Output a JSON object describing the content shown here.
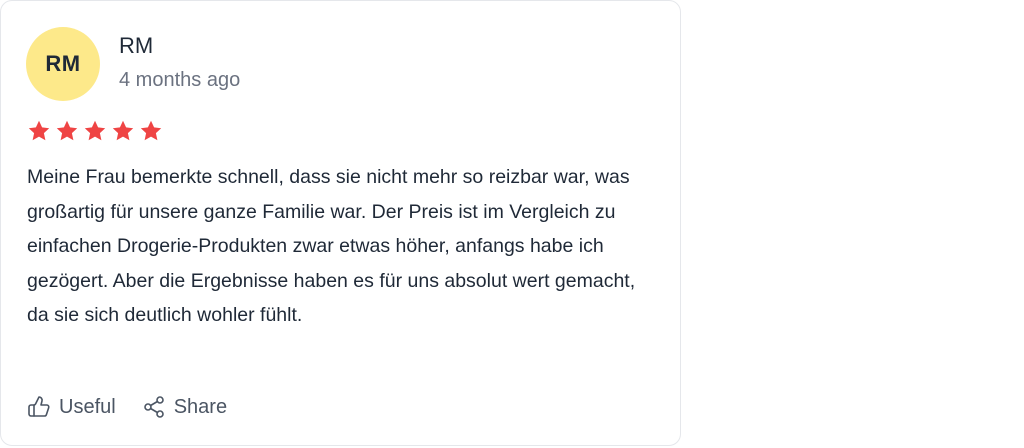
{
  "review": {
    "avatar_initials": "RM",
    "author": "RM",
    "time_ago": "4 months ago",
    "rating": 5,
    "rating_max": 5,
    "star_color": "#ef4444",
    "avatar_color": "#fde98a",
    "text": "Meine Frau bemerkte schnell, dass sie nicht mehr so reizbar war, was großartig für unsere ganze Familie war. Der Preis ist im Vergleich zu einfachen Drogerie-Produkten zwar etwas höher, anfangs habe ich gezögert. Aber die Ergebnisse haben es für uns absolut wert gemacht, da sie sich deutlich wohler fühlt."
  },
  "actions": {
    "useful_label": "Useful",
    "useful_icon": "thumbs-up-icon",
    "share_label": "Share",
    "share_icon": "share-icon"
  }
}
